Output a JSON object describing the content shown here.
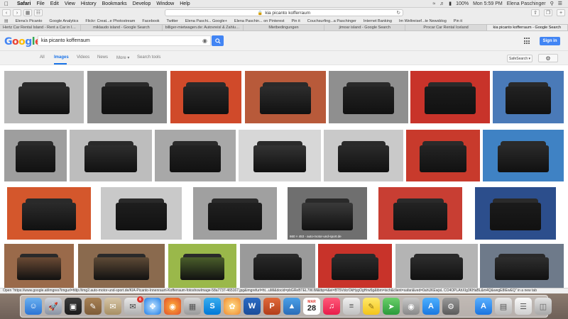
{
  "menubar": {
    "app": "Safari",
    "menus": [
      "File",
      "Edit",
      "View",
      "History",
      "Bookmarks",
      "Develop",
      "Window",
      "Help"
    ],
    "battery": "100%",
    "clock": "Mon 5:59 PM",
    "user": "Elena Paschinger"
  },
  "toolbar": {
    "url": "kia picanto kofferraum"
  },
  "favorites": {
    "items": [
      "Elena's Picanto",
      "Google Analytics",
      "Flickr: Creat...e Photostream",
      "Facebook",
      "Twitter",
      "Elena Paschi... Google+",
      "Elena Paschin... on Pinterest",
      "Pin it",
      "Couchsurfing...a Paschinger",
      "Internet Banking",
      "Im Weltreisef...te Newsblog",
      "Pin it"
    ]
  },
  "tabs": [
    {
      "label": "Hertz Car Rental Island - Rent a Car in Icel...",
      "active": false
    },
    {
      "label": "miklaudo island - Google Search",
      "active": false
    },
    {
      "label": "billiger-mietwagen.de: Autovreisl & Zahlungs...",
      "active": false
    },
    {
      "label": "Mietbedingungen",
      "active": false
    },
    {
      "label": "jimoar island - Google Search",
      "active": false
    },
    {
      "label": "Procar Car Rental Iceland",
      "active": false
    },
    {
      "label": "kia picanto kofferraum - Google Search",
      "active": true
    }
  ],
  "google": {
    "query": "kia picanto kofferraum",
    "signin": "Sign in",
    "nav": [
      "All",
      "Images",
      "Videos",
      "News",
      "More ▾",
      "Search tools"
    ],
    "active_nav": "Images",
    "safesearch": "SafeSearch ▾"
  },
  "results": {
    "rows": [
      [
        {
          "bg": "#b9b9b9",
          "boot": "#2c2c2c"
        },
        {
          "bg": "#8c8c8c",
          "boot": "#1f1f1f"
        },
        {
          "bg": "#d04a2a",
          "boot": "#262626"
        },
        {
          "bg": "#b85a3a",
          "boot": "#2d2d2d"
        },
        {
          "bg": "#8f8f8f",
          "boot": "#242424"
        },
        {
          "bg": "#c8332a",
          "boot": "#1c1c1c"
        },
        {
          "bg": "#4a7ab8",
          "boot": "#222222"
        }
      ],
      [
        {
          "bg": "#9e9e9e",
          "boot": "#262626"
        },
        {
          "bg": "#bdbdbd",
          "boot": "#2e2e2e"
        },
        {
          "bg": "#a8a8a8",
          "boot": "#232323"
        },
        {
          "bg": "#d7d7d7",
          "boot": "#333333"
        },
        {
          "bg": "#c9c9c9",
          "boot": "#2b2b2b"
        },
        {
          "bg": "#c83a2c",
          "boot": "#242424"
        },
        {
          "bg": "#3f82c4",
          "boot": "#2a2a2a"
        }
      ],
      [
        {
          "bg": "#d4572c",
          "boot": "#2b2b2b"
        },
        {
          "bg": "#c9c9c9",
          "boot": "#1e1e1e"
        },
        {
          "bg": "#a0a0a0",
          "boot": "#202020"
        },
        {
          "bg": "#6f6f6f",
          "boot": "#3a3a3a",
          "wm": "660 × 453 - auto-motor-und-sport.de"
        },
        {
          "bg": "#c83e33",
          "boot": "#232323"
        },
        {
          "bg": "#2c4e8c",
          "boot": "#1b1b1b"
        }
      ],
      [
        {
          "bg": "#9a6a4a",
          "boot": "#6a4a34"
        },
        {
          "bg": "#8a6a4e",
          "boot": "#5e4a36"
        },
        {
          "bg": "#9ab84a",
          "boot": "#4a5e2a"
        },
        {
          "bg": "#9a9a9a",
          "boot": "#272727"
        },
        {
          "bg": "#c8332a",
          "boot": "#2a2a2a"
        },
        {
          "bg": "#b4b4b4",
          "boot": "#2c2c2c"
        },
        {
          "bg": "#6e7a8a",
          "boot": "#2e2e2e"
        }
      ]
    ]
  },
  "statusbar": "Open \"https://www.google.at/imgres?imgurl=http://img2.auto-motor-und-sport.de/KIA-Picanto-Innenraum-Kofferraum-fotoshowImage-58a7737-465167.jpg&imgrefurl=ht...uMi&docid=pbGReBTEL7W.IM&tbp=i&ei=BT5VdcrOkHygOgHrw5g&tbm=isch&client=safari&ved=0ahUKEwjsL CO4OPLAhXIg3KHaBL&m4Q&wegE8IEwEQ\" in a new tab",
  "dock": {
    "mail_badge": "6",
    "calendar_day": "28",
    "calendar_month": "MAR"
  }
}
